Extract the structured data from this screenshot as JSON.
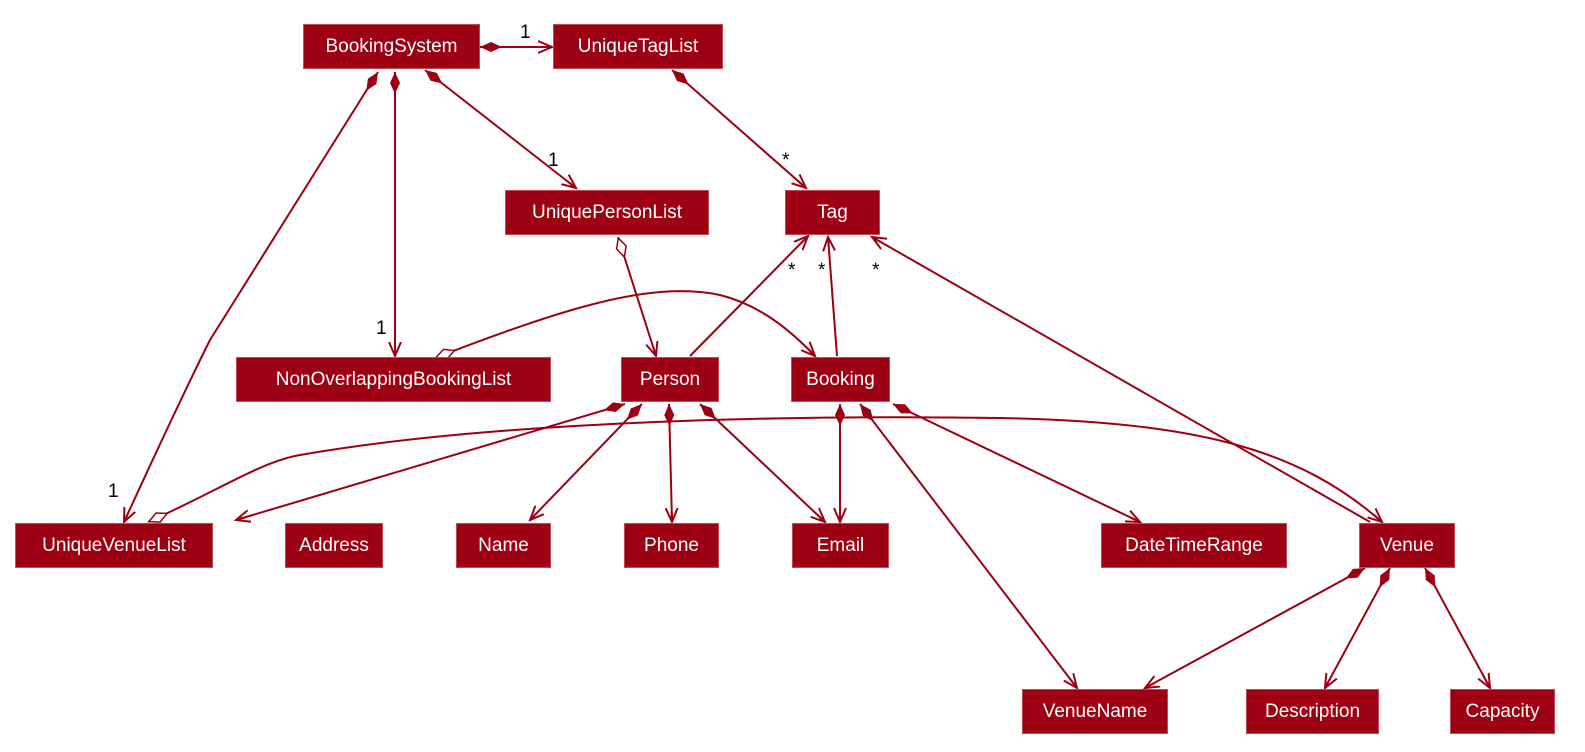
{
  "colors": {
    "class_fill": "#9D0012",
    "class_text": "#FFFFFF",
    "edge": "#9D0012"
  },
  "nodes": {
    "booking_system": "BookingSystem",
    "unique_tag_list": "UniqueTagList",
    "unique_person_list": "UniquePersonList",
    "tag": "Tag",
    "non_overlapping_booking_list": "NonOverlappingBookingList",
    "person": "Person",
    "booking": "Booking",
    "unique_venue_list": "UniqueVenueList",
    "address": "Address",
    "name": "Name",
    "phone": "Phone",
    "email": "Email",
    "date_time_range": "DateTimeRange",
    "venue": "Venue",
    "venue_name": "VenueName",
    "description": "Description",
    "capacity": "Capacity"
  },
  "multiplicities": {
    "bs_utl": "1",
    "bs_uvl": "1",
    "bs_nobl": "1",
    "bs_upl": "1",
    "utl_tag": "*",
    "person_tag": "*",
    "booking_tag": "*",
    "venue_tag": "*"
  }
}
